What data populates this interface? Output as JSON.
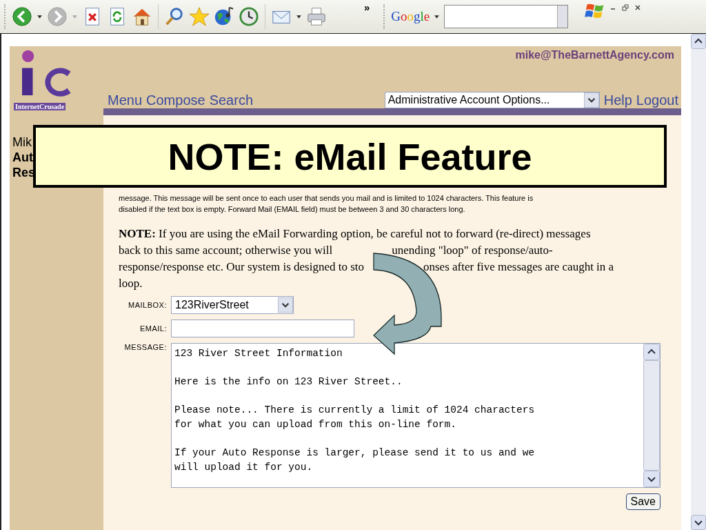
{
  "toolbar": {
    "back": {
      "disabled": false
    },
    "forward": {
      "disabled": true
    },
    "overflow": "»",
    "search_logo": "Google"
  },
  "header": {
    "account": "mike@TheBarnettAgency.com",
    "logo_caption": "InternetCrusade",
    "nav": [
      "Menu",
      "Compose",
      "Search"
    ],
    "options": "Administrative Account Options...",
    "links": [
      "Help",
      "Logout"
    ]
  },
  "sidebar": [
    "Mik",
    "Aut",
    "Res"
  ],
  "callout": "NOTE: eMail Feature",
  "intro": [
    "message. This message will be sent once to each user that sends you mail and is limited to 1024 characters. This feature is",
    "disabled if the text box is empty. Forward Mail (EMAIL field) must be between 3 and 30 characters long."
  ],
  "note_lines": [
    [
      "**NOTE:** If you are using the eMail Forwarding option, be careful not to forward (re-direct) messages"
    ],
    [
      "back to this same account; otherwise you will",
      "unending \"loop\" of response/auto-"
    ],
    [
      "response/response etc. Our system is designed to sto",
      "onses after five messages are caught in a"
    ],
    [
      "loop."
    ]
  ],
  "form": {
    "mailbox_label": "MAILBOX:",
    "mailbox": "123RiverStreet",
    "email_label": "EMAIL:",
    "message_label": "MESSAGE:",
    "message": "123 River Street Information\n\nHere is the info on 123 River Street..\n\nPlease note... There is currently a limit of 1024 characters\nfor what you can upload from this on-line form.\n\nIf your Auto Response is larger, please send it to us and we\nwill upload it for you.",
    "save": "Save"
  }
}
